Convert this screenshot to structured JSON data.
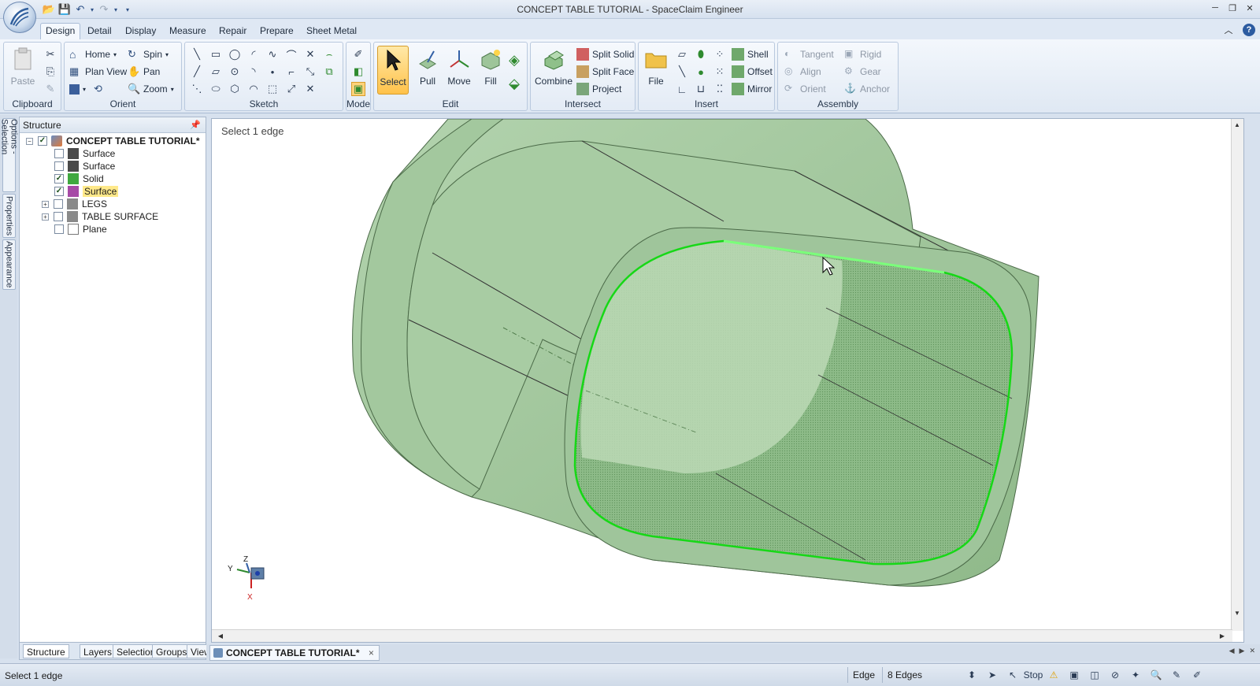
{
  "window": {
    "title": "CONCEPT TABLE TUTORIAL - SpaceClaim Engineer"
  },
  "ribbon_tabs": [
    "Design",
    "Detail",
    "Display",
    "Measure",
    "Repair",
    "Prepare",
    "Sheet Metal"
  ],
  "ribbon": {
    "clipboard": {
      "label": "Clipboard",
      "paste": "Paste"
    },
    "orient": {
      "label": "Orient",
      "home": "Home",
      "spin": "Spin",
      "plan_view": "Plan View",
      "pan": "Pan",
      "zoom": "Zoom"
    },
    "sketch": {
      "label": "Sketch"
    },
    "mode": {
      "label": "Mode"
    },
    "edit": {
      "label": "Edit",
      "select": "Select",
      "pull": "Pull",
      "move": "Move",
      "fill": "Fill"
    },
    "intersect": {
      "label": "Intersect",
      "combine": "Combine",
      "split_solid": "Split Solid",
      "split_face": "Split Face",
      "project": "Project"
    },
    "insert": {
      "label": "Insert",
      "file": "File",
      "shell": "Shell",
      "offset": "Offset",
      "mirror": "Mirror"
    },
    "assembly": {
      "label": "Assembly",
      "tangent": "Tangent",
      "rigid": "Rigid",
      "align": "Align",
      "gear": "Gear",
      "orient": "Orient",
      "anchor": "Anchor"
    }
  },
  "side_tabs": [
    "Options - Selection",
    "Properties",
    "Appearance"
  ],
  "structure": {
    "title": "Structure",
    "root": "CONCEPT TABLE TUTORIAL*",
    "items": [
      {
        "label": "Surface",
        "checked": false
      },
      {
        "label": "Surface",
        "checked": false
      },
      {
        "label": "Solid",
        "checked": true
      },
      {
        "label": "Surface",
        "checked": true
      },
      {
        "label": "LEGS",
        "checked": false
      },
      {
        "label": "TABLE SURFACE",
        "checked": false
      },
      {
        "label": "Plane",
        "checked": false
      }
    ],
    "bottom_tabs": [
      "Structure",
      "Layers",
      "Selection",
      "Groups",
      "Views"
    ]
  },
  "viewport": {
    "prompt": "Select 1 edge",
    "axis": {
      "y": "Y",
      "z": "Z",
      "x": "X"
    }
  },
  "document_tab": {
    "label": "CONCEPT TABLE TUTORIAL*",
    "close": "×"
  },
  "status": {
    "message": "Select 1 edge",
    "filter": "Edge",
    "count": "8 Edges",
    "stop": "Stop"
  },
  "colors": {
    "model_face": "#9fc59b",
    "selection_edge": "#16d816",
    "selected_tool": "#ffc24a"
  }
}
